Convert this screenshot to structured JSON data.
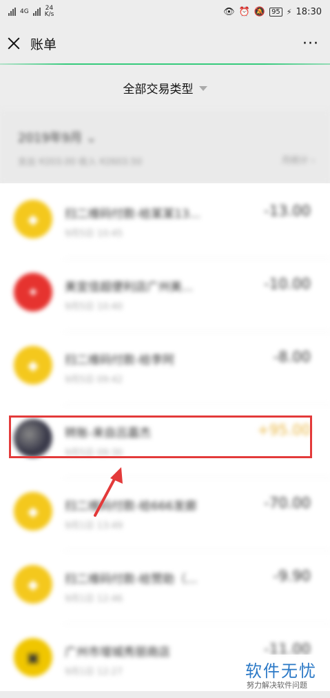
{
  "status_bar": {
    "network1": "4G",
    "network2": "4G",
    "speed_value": "24",
    "speed_unit": "K/s",
    "battery": "95",
    "time": "18:30"
  },
  "nav": {
    "title": "账单",
    "more": "···"
  },
  "filter": {
    "label": "全部交易类型"
  },
  "month": {
    "title": "2019年9月",
    "summary": "支出 ¥203.00 收入 ¥2603.50",
    "stats": "月统计"
  },
  "transactions": [
    {
      "title": "扫二维码付款-给某某13...",
      "time": "9月5日 10:45",
      "amount": "-13.00",
      "avatar": "yellow"
    },
    {
      "title": "美宜佳超便利店广州美...",
      "time": "9月5日 10:40",
      "amount": "-10.00",
      "avatar": "red"
    },
    {
      "title": "扫二维码付款-给李阿",
      "time": "9月5日 09:42",
      "amount": "-8.00",
      "avatar": "yellow"
    },
    {
      "title": "转账-来自吕嘉杰",
      "time": "9月5日 09:30",
      "amount": "+95.00",
      "avatar": "gray"
    },
    {
      "title": "扫二维码付款-给666发廊",
      "time": "9月1日 13:49",
      "amount": "-70.00",
      "avatar": "yellow"
    },
    {
      "title": "扫二维码付款-给赞助（...",
      "time": "9月1日 12:46",
      "amount": "-9.90",
      "avatar": "yellow"
    },
    {
      "title": "广州市增城秀丽商店",
      "time": "9月1日 12:27",
      "amount": "-11.00",
      "avatar": "badge"
    }
  ],
  "watermark": {
    "title": "软件无忧",
    "subtitle": "努力解决软件问题"
  },
  "colors": {
    "accent_green": "#07c160",
    "annotation_red": "#e33a3a",
    "income": "#e8b43c"
  }
}
